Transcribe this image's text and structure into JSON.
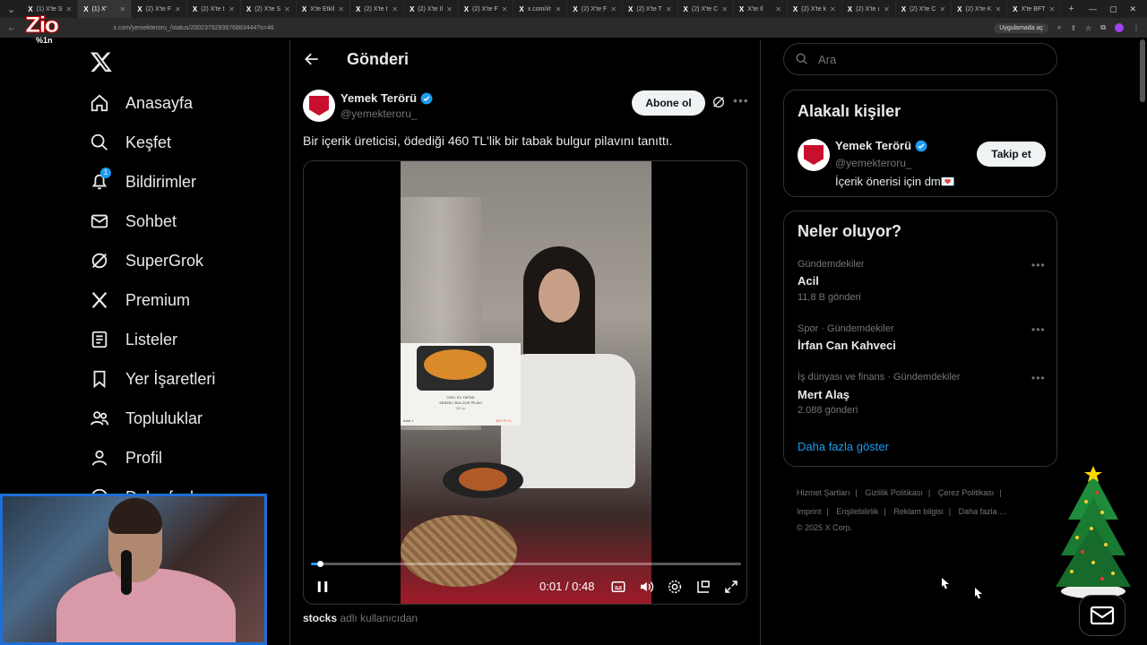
{
  "browser": {
    "tabs": [
      {
        "label": "(1) X'te S",
        "active": false
      },
      {
        "label": "(1) X'",
        "active": true
      },
      {
        "label": "(2) X'te F",
        "active": false
      },
      {
        "label": "(2) X'te t",
        "active": false
      },
      {
        "label": "(2) X'te S",
        "active": false
      },
      {
        "label": "X'te Etkil",
        "active": false
      },
      {
        "label": "(2) X'te t",
        "active": false
      },
      {
        "label": "(2) X'te Il",
        "active": false
      },
      {
        "label": "(2) X'te F",
        "active": false
      },
      {
        "label": "x.com/i/r",
        "active": false
      },
      {
        "label": "(2) X'te F",
        "active": false
      },
      {
        "label": "(2) X'te T",
        "active": false
      },
      {
        "label": "(2) X'te C",
        "active": false
      },
      {
        "label": "X'te Il",
        "active": false
      },
      {
        "label": "(2) X'te k",
        "active": false
      },
      {
        "label": "(2) X'te ı",
        "active": false
      },
      {
        "label": "(2) X'te C",
        "active": false
      },
      {
        "label": "(2) X'te K",
        "active": false
      },
      {
        "label": "X'te BFT",
        "active": false
      }
    ],
    "url": "x.com/yemekteroru_/status/2002379293976883444?s=46",
    "open_in_app": "Uygulamada aç"
  },
  "overlay_logo": {
    "text": "Zio",
    "percent": "%1n"
  },
  "nav": {
    "items": [
      {
        "label": "Anasayfa",
        "icon": "home-icon"
      },
      {
        "label": "Keşfet",
        "icon": "search-icon"
      },
      {
        "label": "Bildirimler",
        "icon": "bell-icon",
        "badge": "1"
      },
      {
        "label": "Sohbet",
        "icon": "mail-icon"
      },
      {
        "label": "SuperGrok",
        "icon": "grok-icon"
      },
      {
        "label": "Premium",
        "icon": "x-icon"
      },
      {
        "label": "Listeler",
        "icon": "list-icon"
      },
      {
        "label": "Yer İşaretleri",
        "icon": "bookmark-icon"
      },
      {
        "label": "Topluluklar",
        "icon": "people-icon"
      },
      {
        "label": "Profil",
        "icon": "person-icon"
      },
      {
        "label": "Daha fazla",
        "icon": "more-circle-icon"
      }
    ]
  },
  "main": {
    "title": "Gönderi",
    "author": {
      "name": "Yemek Terörü",
      "handle": "@yemekteroru_",
      "verified": true
    },
    "subscribe_label": "Abone ol",
    "text": "Bir içerik üreticisi, ödediği 460 TL'lik bir tabak bulgur pilavını tanıttı.",
    "video": {
      "current_time": "0:01",
      "duration": "0:48",
      "time_display": "0:01 / 0:48",
      "progress": 0.02,
      "menu_card": {
        "line1": "ÖZEL EV YAPIMI",
        "line2": "SEBZELİ BULGUR PİLAVI",
        "line3": "350 gr",
        "qty": "Adet 1",
        "price": "459.75 TL"
      }
    },
    "source_note": {
      "user": "stocks",
      "suffix": " adlı kullanıcıdan"
    }
  },
  "right": {
    "search_placeholder": "Ara",
    "related": {
      "title": "Alakalı kişiler",
      "name": "Yemek Terörü",
      "handle": "@yemekteroru_",
      "bio": "İçerik önerisi için dm💌",
      "follow_label": "Takip et"
    },
    "trends": {
      "title": "Neler oluyor?",
      "items": [
        {
          "category": "Gündemdekiler",
          "name": "Acil",
          "count": "11,8 B gönderi"
        },
        {
          "category": "Spor · Gündemdekiler",
          "name": "İrfan Can Kahveci",
          "count": ""
        },
        {
          "category": "İş dünyası ve finans · Gündemdekiler",
          "name": "Mert Alaş",
          "count": "2.088 gönderi"
        }
      ],
      "show_more": "Daha fazla göster"
    },
    "footer": {
      "links": [
        "Hizmet Şartları",
        "Gizlilik Politikası",
        "Çerez Politikası",
        "Imprint",
        "Erişilebilirlik",
        "Reklam bilgisi",
        "Daha fazla ..."
      ],
      "copyright": "© 2025 X Corp."
    }
  },
  "colors": {
    "accent": "#1d9bf0",
    "background": "#000000",
    "text": "#e7e9ea",
    "muted": "#71767b",
    "border": "#2f3336"
  }
}
